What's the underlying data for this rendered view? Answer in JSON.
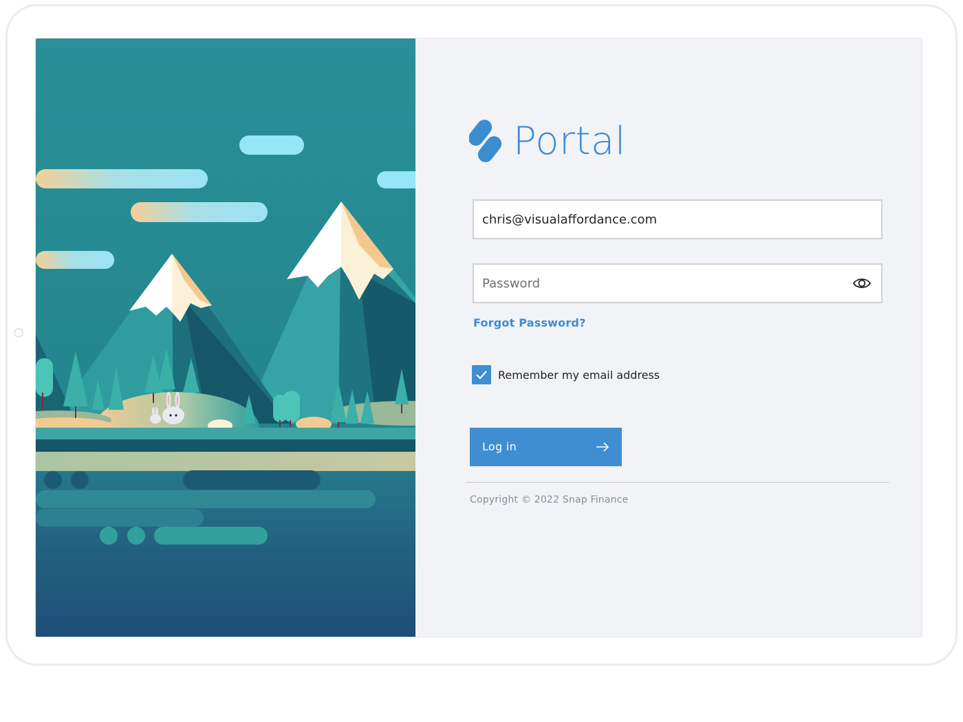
{
  "app": {
    "name": "Portal"
  },
  "login": {
    "email_value": "chris@visualaffordance.com",
    "email_placeholder": "",
    "password_placeholder": "Password",
    "forgot_password": "Forgot Password?",
    "remember_label": "Remember my email address",
    "remember_checked": true,
    "login_label": "Log in"
  },
  "footer": {
    "copyright": "Copyright © 2022 Snap Finance"
  },
  "icons": [
    "snap-logo-icon",
    "eye-icon",
    "checkmark-icon",
    "arrow-right-icon"
  ],
  "colors": {
    "accent": "#3f8ed2",
    "panel_bg": "#f2f3f7",
    "illustration_bg": "#2b8e96"
  }
}
